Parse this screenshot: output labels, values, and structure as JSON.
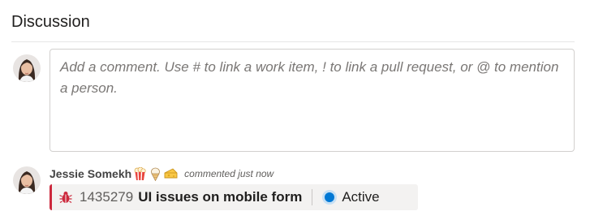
{
  "section": {
    "title": "Discussion"
  },
  "comment_input": {
    "placeholder": "Add a comment. Use # to link a work item, ! to link a pull request, or @ to mention a person.",
    "value": ""
  },
  "comment": {
    "author": "Jessie Somekh",
    "meta": "commented just now",
    "badges": [
      "popcorn-icon",
      "ice-cream-icon",
      "cheese-icon"
    ],
    "work_item": {
      "type_icon": "bug-icon",
      "id": "1435279",
      "title": "UI issues on mobile form",
      "state": "Active",
      "state_color": "#0078d4",
      "type_color": "#cc293d"
    }
  }
}
